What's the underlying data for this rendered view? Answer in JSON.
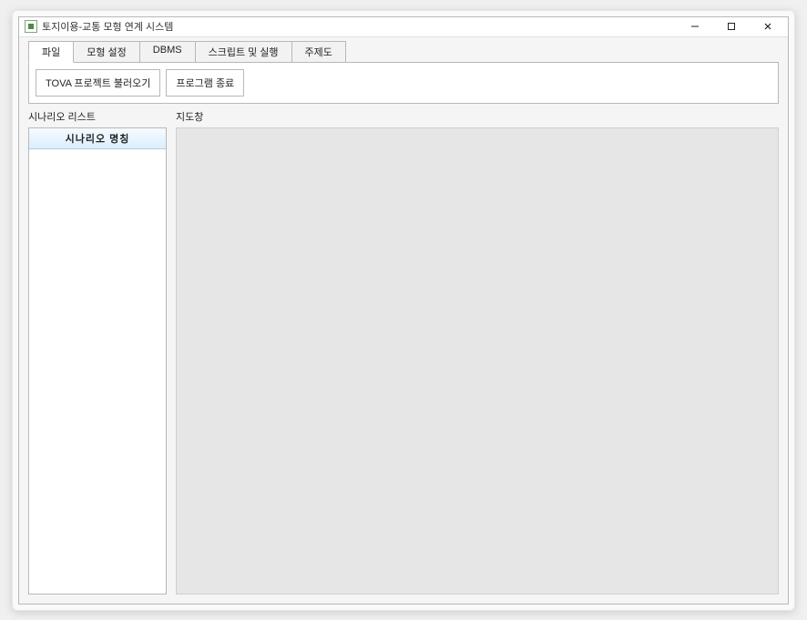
{
  "window": {
    "title": "토지이용-교통 모형 연계 시스템"
  },
  "tabs": [
    {
      "label": "파일",
      "active": true
    },
    {
      "label": "모형 설정",
      "active": false
    },
    {
      "label": "DBMS",
      "active": false
    },
    {
      "label": "스크립트 및 실행",
      "active": false
    },
    {
      "label": "주제도",
      "active": false
    }
  ],
  "toolbar": {
    "load_project_label": "TOVA 프로젝트 불러오기",
    "exit_label": "프로그램 종료"
  },
  "sidebar": {
    "title": "시나리오 리스트",
    "column_header": "시나리오 명칭"
  },
  "map": {
    "title": "지도창"
  }
}
